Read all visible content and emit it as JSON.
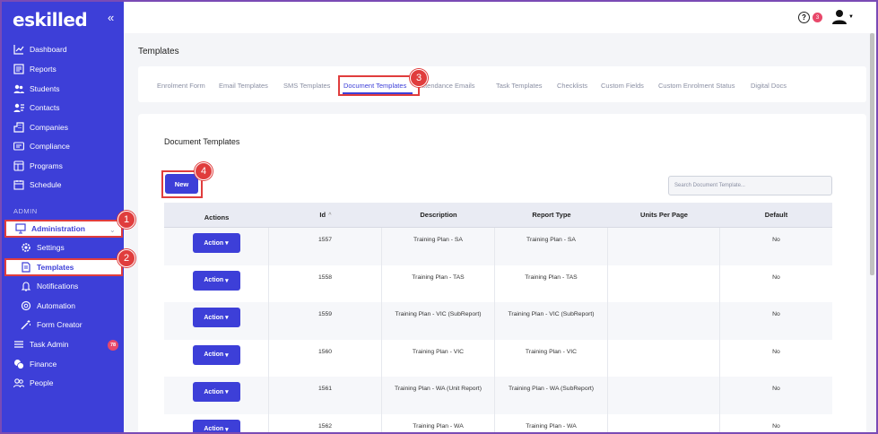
{
  "app": {
    "logo": "eskilled",
    "collapse_icon": "double-chevron-left-icon"
  },
  "sidebar": {
    "items": [
      {
        "label": "Dashboard",
        "icon": "chart-line-icon"
      },
      {
        "label": "Reports",
        "icon": "report-icon"
      },
      {
        "label": "Students",
        "icon": "users-icon"
      },
      {
        "label": "Contacts",
        "icon": "contacts-icon"
      },
      {
        "label": "Companies",
        "icon": "building-icon"
      },
      {
        "label": "Compliance",
        "icon": "id-card-icon"
      },
      {
        "label": "Programs",
        "icon": "window-icon"
      },
      {
        "label": "Schedule",
        "icon": "calendar-icon"
      }
    ],
    "section_label": "ADMIN",
    "admin_items": [
      {
        "label": "Administration",
        "icon": "monitor-icon"
      },
      {
        "label": "Settings",
        "icon": "gear-icon"
      },
      {
        "label": "Templates",
        "icon": "document-icon"
      },
      {
        "label": "Notifications",
        "icon": "bell-icon"
      },
      {
        "label": "Automation",
        "icon": "automation-icon"
      },
      {
        "label": "Form Creator",
        "icon": "magic-wand-icon"
      },
      {
        "label": "Task Admin",
        "icon": "list-icon",
        "badge": "78"
      },
      {
        "label": "Finance",
        "icon": "coins-icon"
      },
      {
        "label": "People",
        "icon": "people-icon"
      }
    ]
  },
  "topbar": {
    "help": "?",
    "notifications": "3"
  },
  "page": {
    "title": "Templates"
  },
  "tabs": [
    {
      "label": "Enrolment Form"
    },
    {
      "label": "Email Templates"
    },
    {
      "label": "SMS Templates"
    },
    {
      "label": "Document Templates",
      "active": true
    },
    {
      "label": "Attendance Emails"
    },
    {
      "label": "Task Templates"
    },
    {
      "label": "Checklists"
    },
    {
      "label": "Custom Fields"
    },
    {
      "label": "Custom Enrolment Status"
    },
    {
      "label": "Digital Docs"
    }
  ],
  "card": {
    "title": "Document Templates",
    "new_label": "New",
    "search_placeholder": "Search Document Template..."
  },
  "table": {
    "headers": [
      "Actions",
      "Id",
      "Description",
      "Report Type",
      "Units Per Page",
      "Default"
    ],
    "sort_indicator": "^",
    "action_label": "Action",
    "rows": [
      {
        "id": "1557",
        "description": "Training Plan - SA",
        "report_type": "Training Plan - SA",
        "units": "",
        "default": "No"
      },
      {
        "id": "1558",
        "description": "Training Plan - TAS",
        "report_type": "Training Plan - TAS",
        "units": "",
        "default": "No"
      },
      {
        "id": "1559",
        "description": "Training Plan - VIC (SubReport)",
        "report_type": "Training Plan - VIC (SubReport)",
        "units": "",
        "default": "No"
      },
      {
        "id": "1560",
        "description": "Training Plan - VIC",
        "report_type": "Training Plan - VIC",
        "units": "",
        "default": "No"
      },
      {
        "id": "1561",
        "description": "Training Plan - WA (Unit Report)",
        "report_type": "Training Plan - WA (SubReport)",
        "units": "",
        "default": "No"
      },
      {
        "id": "1562",
        "description": "Training Plan - WA",
        "report_type": "Training Plan - WA",
        "units": "",
        "default": "No"
      }
    ]
  },
  "annotations": [
    "1",
    "2",
    "3",
    "4"
  ]
}
